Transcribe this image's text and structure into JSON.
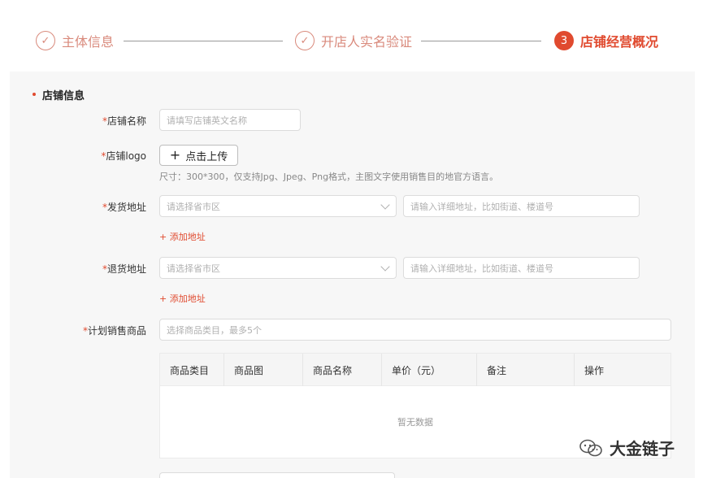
{
  "steps": [
    {
      "label": "主体信息",
      "status": "done",
      "marker": "✓"
    },
    {
      "label": "开店人实名验证",
      "status": "done",
      "marker": "✓"
    },
    {
      "label": "店铺经营概况",
      "status": "active",
      "marker": "3"
    }
  ],
  "section": {
    "title": "店铺信息"
  },
  "form": {
    "required_mark": "*",
    "store_name": {
      "label": "店铺名称",
      "placeholder": "请填写店铺英文名称"
    },
    "store_logo": {
      "label": "店铺logo",
      "button": "点击上传",
      "hint": "尺寸：300*300，仅支持Jpg、Jpeg、Png格式，主图文字使用销售目的地官方语言。"
    },
    "ship_address": {
      "label": "发货地址",
      "region_placeholder": "请选择省市区",
      "detail_placeholder": "请输入详细地址，比如街道、楼道号",
      "add_link": "+ 添加地址"
    },
    "return_address": {
      "label": "退货地址",
      "region_placeholder": "请选择省市区",
      "detail_placeholder": "请输入详细地址，比如街道、楼道号",
      "add_link": "+ 添加地址"
    },
    "plan_products": {
      "label": "计划销售商品",
      "placeholder": "选择商品类目，最多5个"
    }
  },
  "table": {
    "columns": [
      "商品类目",
      "商品图",
      "商品名称",
      "单价（元）",
      "备注",
      "操作"
    ],
    "empty_text": "暂无数据"
  },
  "watermark": {
    "text": "大金链子",
    "icon": "wechat-icon"
  },
  "colors": {
    "accent": "#e04a2f",
    "done": "#d98a7c",
    "panel_bg": "#f7f7f7"
  }
}
